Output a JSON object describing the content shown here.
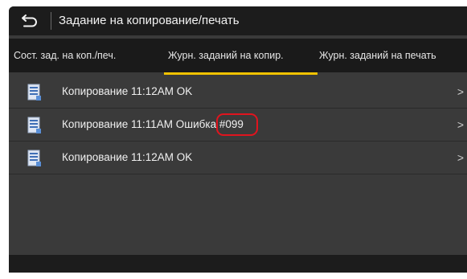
{
  "header": {
    "back_icon": "back-arrow-icon",
    "title": "Задание на копирование/печать"
  },
  "tabs": [
    {
      "label": "Сост. зад. на коп./печ.",
      "selected": false
    },
    {
      "label": "Журн. заданий на копир.",
      "selected": true
    },
    {
      "label": "Журн. заданий на печать",
      "selected": false
    }
  ],
  "accent_color": "#f2c200",
  "highlight_color": "#e0141e",
  "jobs": [
    {
      "icon": "document-icon",
      "text": "Копирование 11:12AM OK",
      "error_code": "",
      "chevron": ">"
    },
    {
      "icon": "document-icon",
      "text": "Копирование 11:11AM Ошибка ",
      "error_code": "#099",
      "chevron": ">"
    },
    {
      "icon": "document-icon",
      "text": "Копирование 11:12AM OK",
      "error_code": "",
      "chevron": ">"
    }
  ]
}
